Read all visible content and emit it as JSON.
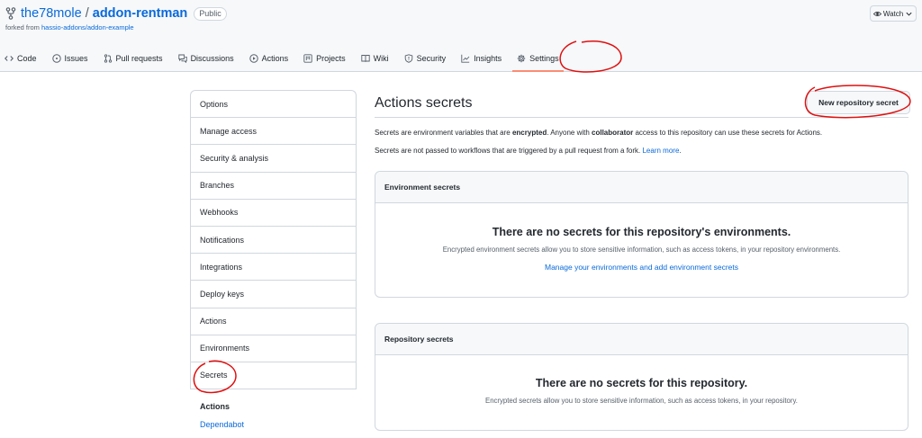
{
  "repo": {
    "owner": "the78mole",
    "separator": "/",
    "name": "addon-rentman",
    "visibility": "Public",
    "forked_prefix": "forked from ",
    "forked_from": "hassio-addons/addon-example"
  },
  "watch": {
    "label": "Watch"
  },
  "tabs": [
    {
      "label": "Code",
      "icon": "code-icon"
    },
    {
      "label": "Issues",
      "icon": "issue-icon"
    },
    {
      "label": "Pull requests",
      "icon": "pull-request-icon"
    },
    {
      "label": "Discussions",
      "icon": "discussion-icon"
    },
    {
      "label": "Actions",
      "icon": "play-icon"
    },
    {
      "label": "Projects",
      "icon": "project-icon"
    },
    {
      "label": "Wiki",
      "icon": "book-icon"
    },
    {
      "label": "Security",
      "icon": "shield-icon"
    },
    {
      "label": "Insights",
      "icon": "graph-icon"
    },
    {
      "label": "Settings",
      "icon": "gear-icon",
      "selected": true
    }
  ],
  "sidebar": {
    "items": [
      {
        "label": "Options"
      },
      {
        "label": "Manage access"
      },
      {
        "label": "Security & analysis"
      },
      {
        "label": "Branches"
      },
      {
        "label": "Webhooks"
      },
      {
        "label": "Notifications"
      },
      {
        "label": "Integrations"
      },
      {
        "label": "Deploy keys"
      },
      {
        "label": "Actions"
      },
      {
        "label": "Environments"
      },
      {
        "label": "Secrets",
        "selected": true
      }
    ],
    "group_title": "Actions",
    "sub_item": "Dependabot"
  },
  "main": {
    "title": "Actions secrets",
    "new_button": "New repository secret",
    "desc1_a": "Secrets are environment variables that are ",
    "desc1_b": "encrypted",
    "desc1_c": ". Anyone with ",
    "desc1_d": "collaborator",
    "desc1_e": " access to this repository can use these secrets for Actions.",
    "desc2": "Secrets are not passed to workflows that are triggered by a pull request from a fork. ",
    "desc2_link": "Learn more",
    "desc2_end": "."
  },
  "env_box": {
    "header": "Environment secrets",
    "title": "There are no secrets for this repository's environments.",
    "desc": "Encrypted environment secrets allow you to store sensitive information, such as access tokens, in your repository environments.",
    "link": "Manage your environments and add environment secrets"
  },
  "repo_box": {
    "header": "Repository secrets",
    "title": "There are no secrets for this repository.",
    "desc": "Encrypted secrets allow you to store sensitive information, such as access tokens, in your repository."
  },
  "colors": {
    "link": "#0969da",
    "border": "#d0d7de",
    "annotation": "#e01010",
    "tab_underline": "#fd8c73"
  }
}
